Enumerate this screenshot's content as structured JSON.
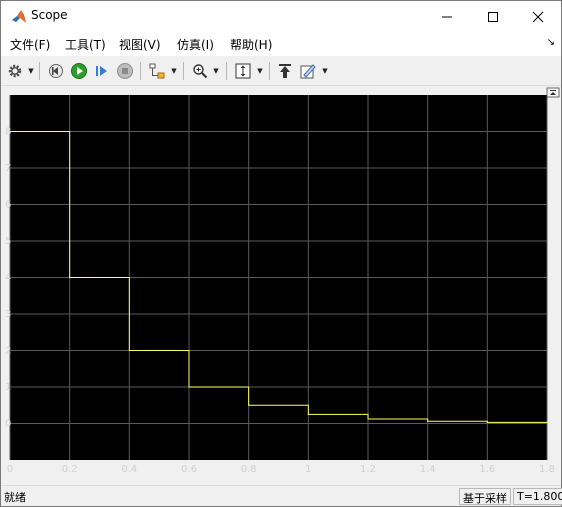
{
  "window": {
    "title": "Scope"
  },
  "menu": [
    "文件(F)",
    "工具(T)",
    "视图(V)",
    "仿真(I)",
    "帮助(H)"
  ],
  "toolbar": {
    "icons": [
      "gear-icon",
      "step-back-icon",
      "run-icon",
      "step-forward-icon",
      "stop-icon",
      "signal-select-icon",
      "zoom-icon",
      "autoscale-icon",
      "highlight-block-icon",
      "style-icon"
    ]
  },
  "status": {
    "left": "就绪",
    "sample_mode": "基于采样",
    "time": "T=1.800"
  },
  "colors": {
    "plot_bg": "#000000",
    "grid": "#5a5a5a",
    "trace": "#ffff66",
    "axis_text": "#d0d0d0"
  },
  "chart_data": {
    "type": "line",
    "step": true,
    "xlim": [
      0,
      1.8
    ],
    "ylim": [
      -1,
      9
    ],
    "xticks": [
      "0",
      "0.2",
      "0.4",
      "0.6",
      "0.8",
      "1",
      "1.2",
      "1.4",
      "1.6",
      "1.8"
    ],
    "yticks": [
      "0",
      "1",
      "2",
      "3",
      "4",
      "5",
      "6",
      "7",
      "8"
    ],
    "grid": true,
    "series": [
      {
        "x": [
          0,
          0.2,
          0.4,
          0.6,
          0.8,
          1.0,
          1.2,
          1.4,
          1.6,
          1.8
        ],
        "y": [
          8,
          4,
          2,
          1,
          0.5,
          0.25,
          0.125,
          0.0625,
          0.03125,
          0.03125
        ]
      }
    ]
  }
}
